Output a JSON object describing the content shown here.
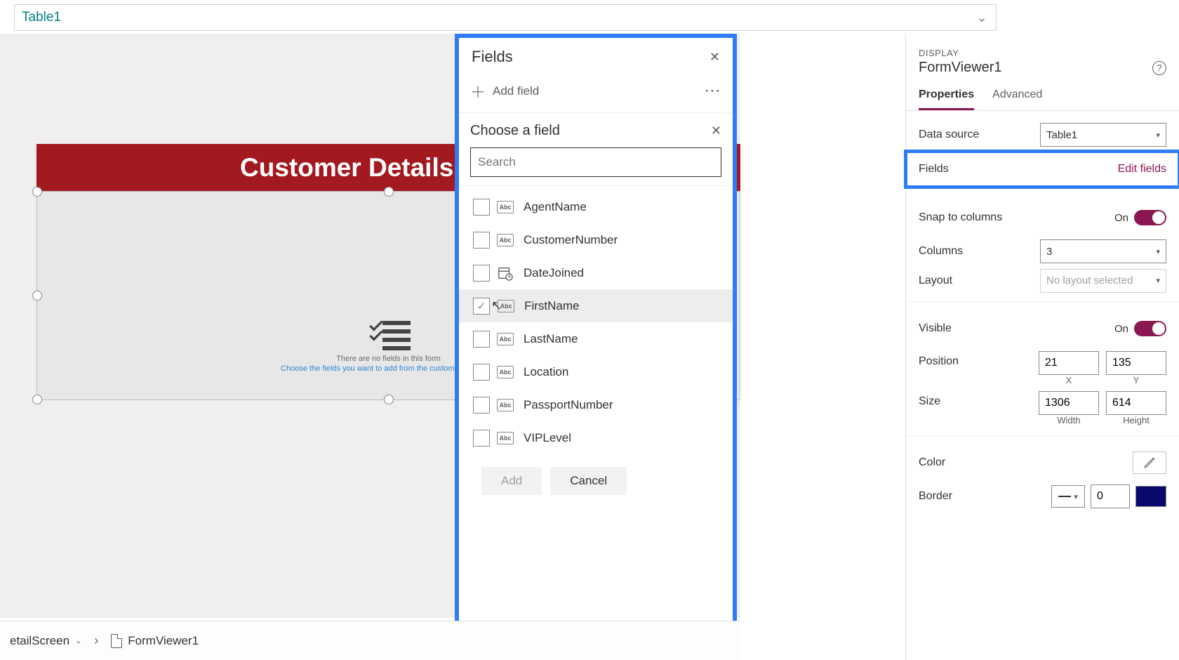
{
  "formulaBar": {
    "value": "Table1"
  },
  "canvas": {
    "headerTitle": "Customer Details",
    "emptyLine1": "There are no fields in this form",
    "emptyLine2": "Choose the fields you want to add from the customization pane"
  },
  "fieldsPanel": {
    "title": "Fields",
    "addField": "Add field",
    "chooseTitle": "Choose a field",
    "searchPlaceholder": "Search",
    "items": [
      {
        "name": "AgentName",
        "type": "Abc",
        "checked": false,
        "hover": false
      },
      {
        "name": "CustomerNumber",
        "type": "Abc",
        "checked": false,
        "hover": false
      },
      {
        "name": "DateJoined",
        "type": "date",
        "checked": false,
        "hover": false
      },
      {
        "name": "FirstName",
        "type": "Abc",
        "checked": true,
        "hover": true
      },
      {
        "name": "LastName",
        "type": "Abc",
        "checked": false,
        "hover": false
      },
      {
        "name": "Location",
        "type": "Abc",
        "checked": false,
        "hover": false
      },
      {
        "name": "PassportNumber",
        "type": "Abc",
        "checked": false,
        "hover": false
      },
      {
        "name": "VIPLevel",
        "type": "Abc",
        "checked": false,
        "hover": false
      }
    ],
    "addBtn": "Add",
    "cancelBtn": "Cancel"
  },
  "props": {
    "sectionLabel": "DISPLAY",
    "controlName": "FormViewer1",
    "tabs": {
      "properties": "Properties",
      "advanced": "Advanced"
    },
    "dataSourceLabel": "Data source",
    "dataSourceValue": "Table1",
    "fieldsLabel": "Fields",
    "editFields": "Edit fields",
    "snapLabel": "Snap to columns",
    "snapValue": "On",
    "columnsLabel": "Columns",
    "columnsValue": "3",
    "layoutLabel": "Layout",
    "layoutValue": "No layout selected",
    "visibleLabel": "Visible",
    "visibleValue": "On",
    "positionLabel": "Position",
    "posX": "21",
    "posXLabel": "X",
    "posY": "135",
    "posYLabel": "Y",
    "sizeLabel": "Size",
    "sizeW": "1306",
    "sizeWLabel": "Width",
    "sizeH": "614",
    "sizeHLabel": "Height",
    "colorLabel": "Color",
    "borderLabel": "Border",
    "borderWidth": "0"
  },
  "crumbs": {
    "screen": "etailScreen",
    "control": "FormViewer1"
  }
}
